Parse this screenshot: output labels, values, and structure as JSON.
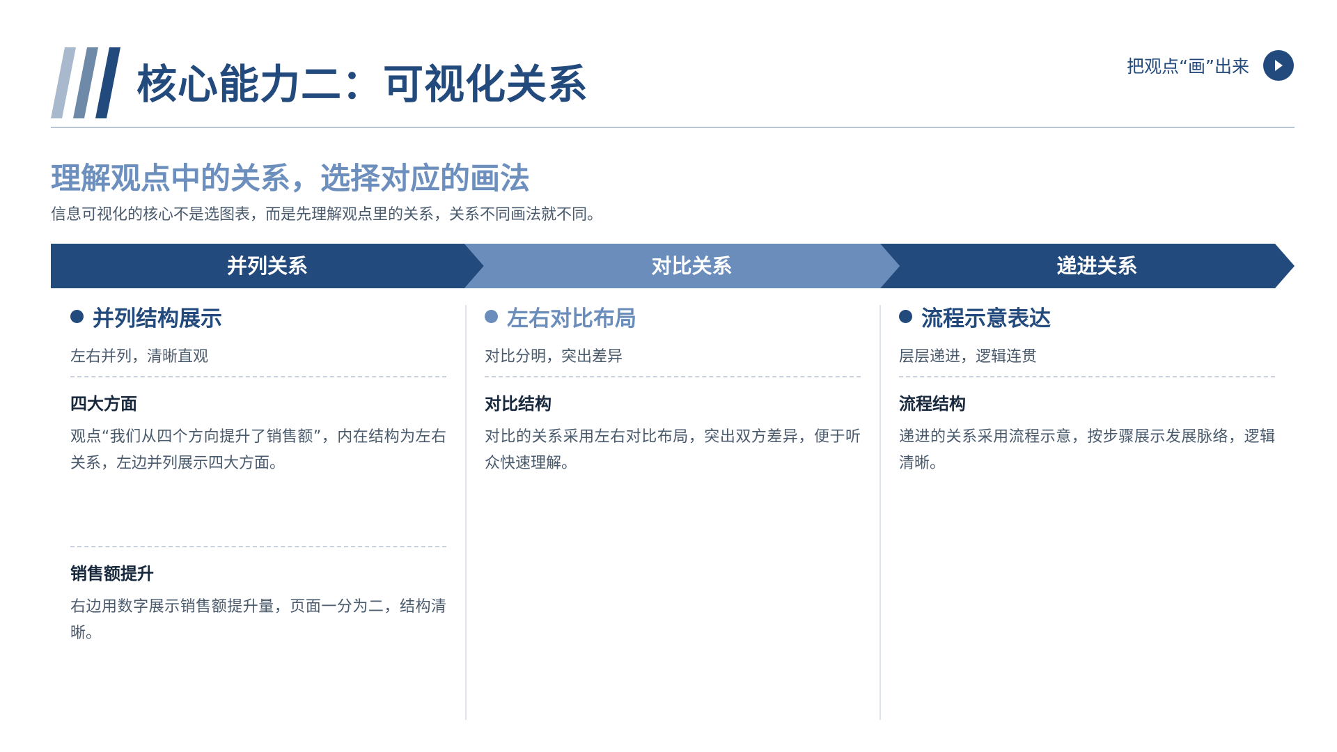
{
  "header": {
    "title": "核心能力二：可视化关系",
    "tag_label": "把观点“画”出来"
  },
  "intro": {
    "heading": "理解观点中的关系，选择对应的画法",
    "description": "信息可视化的核心不是选图表，而是先理解观点里的关系，关系不同画法就不同。"
  },
  "arrows": [
    {
      "label": "并列关系",
      "color": "#234a7c"
    },
    {
      "label": "对比关系",
      "color": "#6a8dbc"
    },
    {
      "label": "递进关系",
      "color": "#234a7c"
    }
  ],
  "columns": [
    {
      "title": "并列结构展示",
      "title_color": "#234a7c",
      "subtitle": "左右并列，清晰直观",
      "blocks": [
        {
          "title": "四大方面",
          "text": "观点“我们从四个方向提升了销售额”，内在结构为左右关系，左边并列展示四大方面。"
        },
        {
          "title": "销售额提升",
          "text": "右边用数字展示销售额提升量，页面一分为二，结构清晰。"
        }
      ]
    },
    {
      "title": "左右对比布局",
      "title_color": "#6a8dbc",
      "subtitle": "对比分明，突出差异",
      "blocks": [
        {
          "title": "对比结构",
          "text": "对比的关系采用左右对比布局，突出双方差异，便于听众快速理解。"
        }
      ]
    },
    {
      "title": "流程示意表达",
      "title_color": "#234a7c",
      "subtitle": "层层递进，逻辑连贯",
      "blocks": [
        {
          "title": "流程结构",
          "text": "递进的关系采用流程示意，按步骤展示发展脉络，逻辑清晰。"
        }
      ]
    }
  ],
  "colors": {
    "primary": "#234a7c",
    "accent": "#6a8dbc",
    "stripe_light": "#a8b9cd",
    "stripe_mid": "#6f8aa8"
  }
}
